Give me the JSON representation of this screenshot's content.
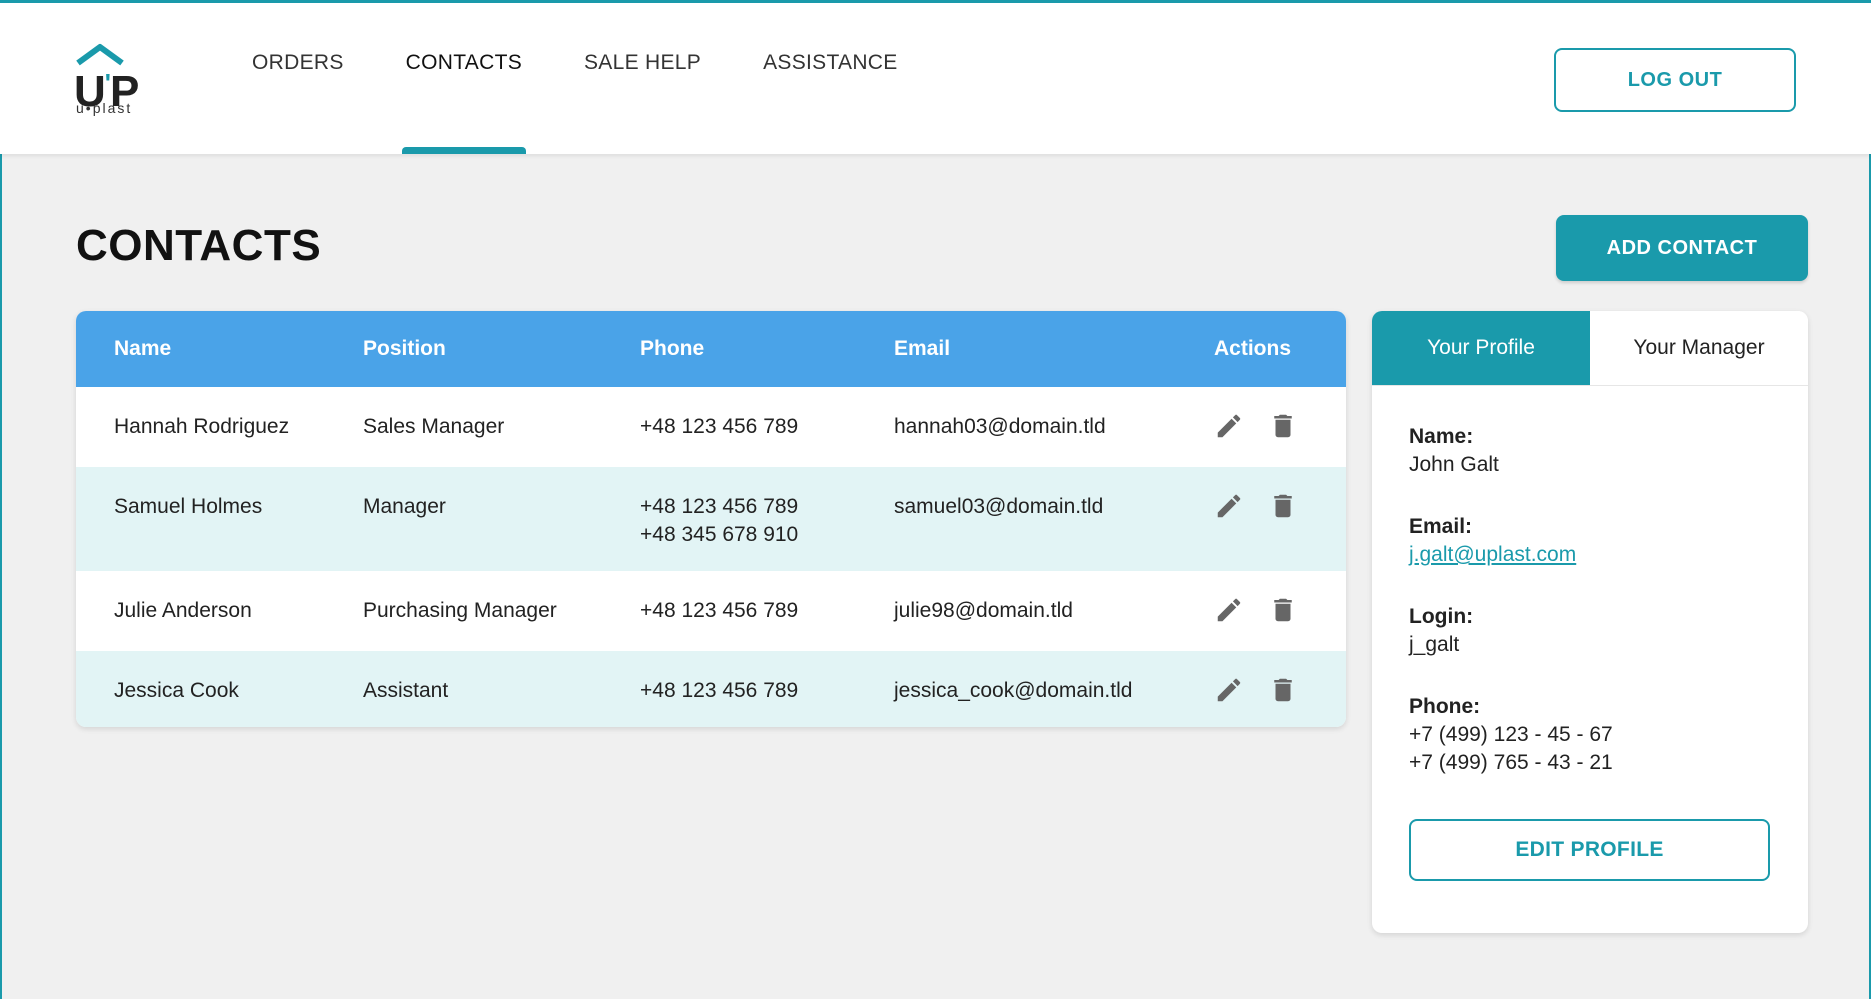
{
  "brand": {
    "mark": "U",
    "mark2": "P",
    "sub": "u•plast",
    "accent_color": "#1a9aab",
    "header_blue": "#4aa3e8"
  },
  "nav": {
    "items": [
      {
        "label": "ORDERS"
      },
      {
        "label": "CONTACTS"
      },
      {
        "label": "SALE HELP"
      },
      {
        "label": "ASSISTANCE"
      }
    ],
    "active": "CONTACTS",
    "logout_label": "LOG OUT"
  },
  "page": {
    "title": "CONTACTS",
    "add_label": "ADD CONTACT"
  },
  "table": {
    "headers": {
      "name": "Name",
      "position": "Position",
      "phone": "Phone",
      "email": "Email",
      "actions": "Actions"
    },
    "rows": [
      {
        "name": "Hannah Rodriguez",
        "position": "Sales Manager",
        "phone1": "+48 123 456 789",
        "phone2": "",
        "email": "hannah03@domain.tld"
      },
      {
        "name": "Samuel Holmes",
        "position": "Manager",
        "phone1": "+48 123 456 789",
        "phone2": "+48 345 678 910",
        "email": "samuel03@domain.tld"
      },
      {
        "name": "Julie Anderson",
        "position": "Purchasing Manager",
        "phone1": "+48 123 456 789",
        "phone2": "",
        "email": "julie98@domain.tld"
      },
      {
        "name": "Jessica Cook",
        "position": "Assistant",
        "phone1": "+48 123 456 789",
        "phone2": "",
        "email": "jessica_cook@domain.tld"
      }
    ],
    "row_icons": [
      "pencil-icon",
      "trash-icon"
    ]
  },
  "profile": {
    "tabs": [
      "Your Profile",
      "Your Manager"
    ],
    "name_label": "Name:",
    "name": "John Galt",
    "email_label": "Email:",
    "email": "j.galt@uplast.com",
    "login_label": "Login:",
    "login": "j_galt",
    "phone_label": "Phone:",
    "phone1": "+7 (499) 123 - 45 - 67",
    "phone2": "+7 (499) 765 - 43 - 21",
    "edit_label": "EDIT PROFILE"
  }
}
